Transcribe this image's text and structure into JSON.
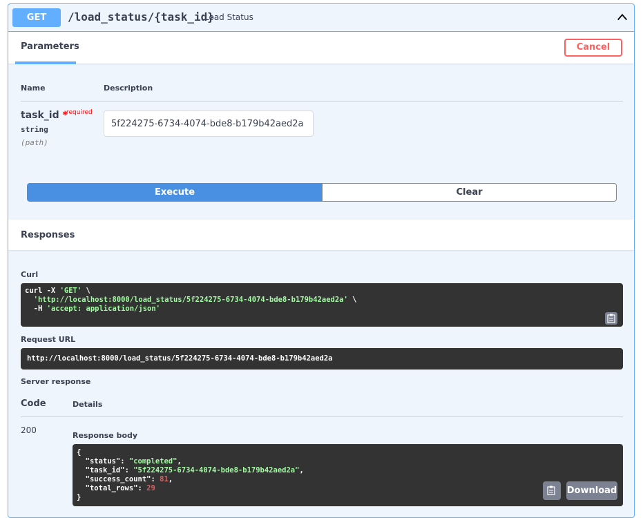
{
  "endpoint": {
    "method": "GET",
    "path": "/load_status/{task_id}",
    "summary": "Load Status"
  },
  "colors": {
    "accent": "#61affe",
    "execute": "#4990e2",
    "cancel": "#ff6060",
    "code_bg": "#333333",
    "code_string": "#a2fca2",
    "code_number": "#d36363"
  },
  "parameters": {
    "tab_label": "Parameters",
    "cancel_label": "Cancel",
    "col_name": "Name",
    "col_description": "Description",
    "items": [
      {
        "name": "task_id",
        "required_marker": "*",
        "required_label": "required",
        "type": "string",
        "in": "(path)",
        "value": "5f224275-6734-4074-bde8-b179b42aed2a"
      }
    ],
    "execute_label": "Execute",
    "clear_label": "Clear"
  },
  "responses": {
    "title": "Responses",
    "curl_label": "Curl",
    "curl": {
      "line1_cmd": "curl -X ",
      "line1_str": "'GET'",
      "line1_end": " \\",
      "line2_str": "'http://localhost:8000/load_status/5f224275-6734-4074-bde8-b179b42aed2a'",
      "line2_end": " \\",
      "line3_cmd": "-H ",
      "line3_str": "'accept: application/json'"
    },
    "request_url_label": "Request URL",
    "request_url": "http://localhost:8000/load_status/5f224275-6734-4074-bde8-b179b42aed2a",
    "server_response_label": "Server response",
    "code_header": "Code",
    "details_header": "Details",
    "code": "200",
    "response_body_label": "Response body",
    "body": {
      "open": "{",
      "status_key": "\"status\"",
      "status_val": "\"completed\"",
      "task_id_key": "\"task_id\"",
      "task_id_val": "\"5f224275-6734-4074-bde8-b179b42aed2a\"",
      "success_count_key": "\"success_count\"",
      "success_count_val": "81",
      "total_rows_key": "\"total_rows\"",
      "total_rows_val": "29",
      "close": "}"
    },
    "download_label": "Download"
  }
}
